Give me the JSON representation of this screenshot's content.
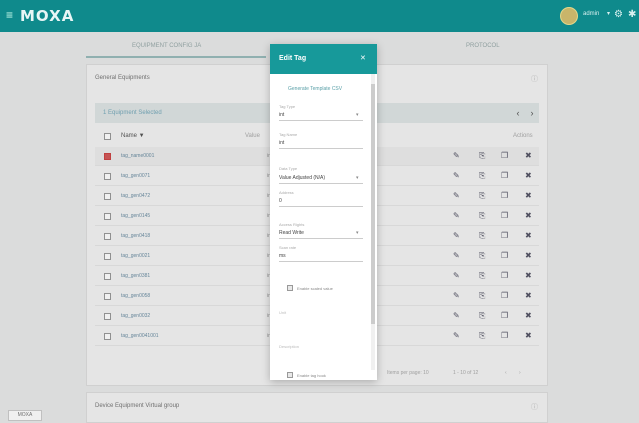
{
  "app": {
    "logo": "MOXA",
    "user_name": "admin",
    "user_caret": "▾",
    "icons": [
      "menu-icon",
      "settings-icon",
      "gear-icon"
    ]
  },
  "tabs": [
    {
      "label": "EQUIPMENT CONFIG JA"
    },
    {
      "label": "PROTOCOL"
    }
  ],
  "main_card": {
    "title": "General Equipments",
    "action_icon": "info-icon",
    "subbar_label": "1 Equipment Selected",
    "nav_prev": "‹",
    "nav_next": "›",
    "columns": {
      "name": "Name ▼",
      "value": "Value",
      "actions": "Actions"
    },
    "rows": [
      {
        "name": "tag_name0001",
        "value": "int",
        "selected": true
      },
      {
        "name": "tag_gen0071",
        "value": "int",
        "selected": false
      },
      {
        "name": "tag_gen0472",
        "value": "int",
        "selected": false
      },
      {
        "name": "tag_gen0145",
        "value": "int",
        "selected": false
      },
      {
        "name": "tag_gen0418",
        "value": "int",
        "selected": false
      },
      {
        "name": "tag_gen0021",
        "value": "int",
        "selected": false
      },
      {
        "name": "tag_gen0381",
        "value": "int",
        "selected": false
      },
      {
        "name": "tag_gen0058",
        "value": "int",
        "selected": false
      },
      {
        "name": "tag_gen0032",
        "value": "int",
        "selected": false
      },
      {
        "name": "tag_gen0041001",
        "value": "int",
        "selected": false
      }
    ],
    "row_actions": {
      "edit": "✎",
      "copy": "⎘",
      "duplicate": "❐",
      "delete": "✖"
    },
    "pagination": [
      "Items per page: 10",
      "1 - 10 of 12",
      "‹",
      "›"
    ]
  },
  "bottom_card": {
    "title": "Device Equipment Virtual group",
    "action_icon": "info-icon"
  },
  "corner_badge": "MOXA",
  "dialog": {
    "title": "Edit Tag",
    "close": "✕",
    "link": "Generate Template CSV",
    "fields": [
      {
        "label": "Tag Type",
        "value": "int"
      },
      {
        "label": "Tag Name",
        "value": "int"
      },
      {
        "label": "Data Type",
        "value": "Value Adjusted (N/A)"
      },
      {
        "label": "Address",
        "value": "0"
      },
      {
        "label": "Access Rights",
        "value": "Read Write"
      },
      {
        "label": "Scan rate",
        "value": "ms"
      }
    ],
    "checkbox1_label": "Enable scaled value",
    "muted1": "Unit",
    "muted2": "Description",
    "checkbox2_label": "Enable tag hook"
  }
}
